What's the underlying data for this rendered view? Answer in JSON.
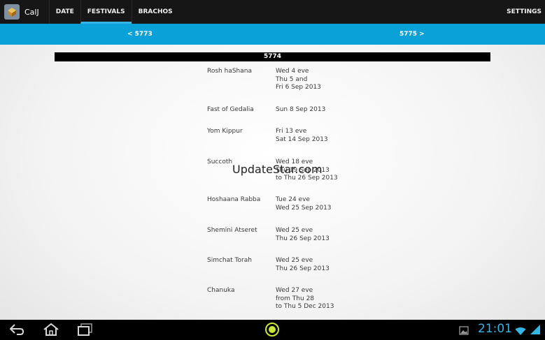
{
  "app": {
    "title": "CalJ",
    "icon": "calendar-app-icon"
  },
  "tabs": [
    {
      "label": "DATE",
      "active": false
    },
    {
      "label": "FESTIVALS",
      "active": true
    },
    {
      "label": "BRACHOS",
      "active": false
    }
  ],
  "settings_label": "SETTINGS",
  "year_nav": {
    "prev": "< 5773",
    "next": "5775 >"
  },
  "year": "5774",
  "festivals": [
    {
      "name": "Rosh haShana",
      "lines": [
        "Wed 4 eve",
        "Thu 5 and",
        "Fri 6 Sep 2013"
      ]
    },
    {
      "name": "Fast of Gedalia",
      "lines": [
        "Sun 8 Sep 2013"
      ]
    },
    {
      "name": "Yom Kippur",
      "lines": [
        "Fri 13 eve",
        "Sat 14 Sep 2013"
      ]
    },
    {
      "name": "Succoth",
      "lines": [
        "Wed 18 eve",
        "Thu 19 Sep 2013",
        "to Thu 26 Sep 2013"
      ]
    },
    {
      "name": "Hoshaana Rabba",
      "lines": [
        "Tue 24 eve",
        "Wed 25 Sep 2013"
      ]
    },
    {
      "name": "Shemini Atseret",
      "lines": [
        "Wed 25 eve",
        "Thu 26 Sep 2013"
      ]
    },
    {
      "name": "Simchat Torah",
      "lines": [
        "Wed 25 eve",
        "Thu 26 Sep 2013"
      ]
    },
    {
      "name": "Chanuka",
      "lines": [
        "Wed 27 eve",
        "from Thu 28",
        "to Thu 5 Dec 2013"
      ]
    }
  ],
  "watermark": "UpdateStar.com",
  "system_bar": {
    "clock": "21:01",
    "icons": [
      "back-icon",
      "home-icon",
      "recent-apps-icon",
      "launcher-icon",
      "gallery-icon",
      "wifi-icon",
      "battery-icon"
    ],
    "accent_color": "#33b5e5"
  },
  "colors": {
    "action_bar": "#161616",
    "year_nav": "#0aa0d8",
    "tab_indicator": "#33b5e5"
  }
}
